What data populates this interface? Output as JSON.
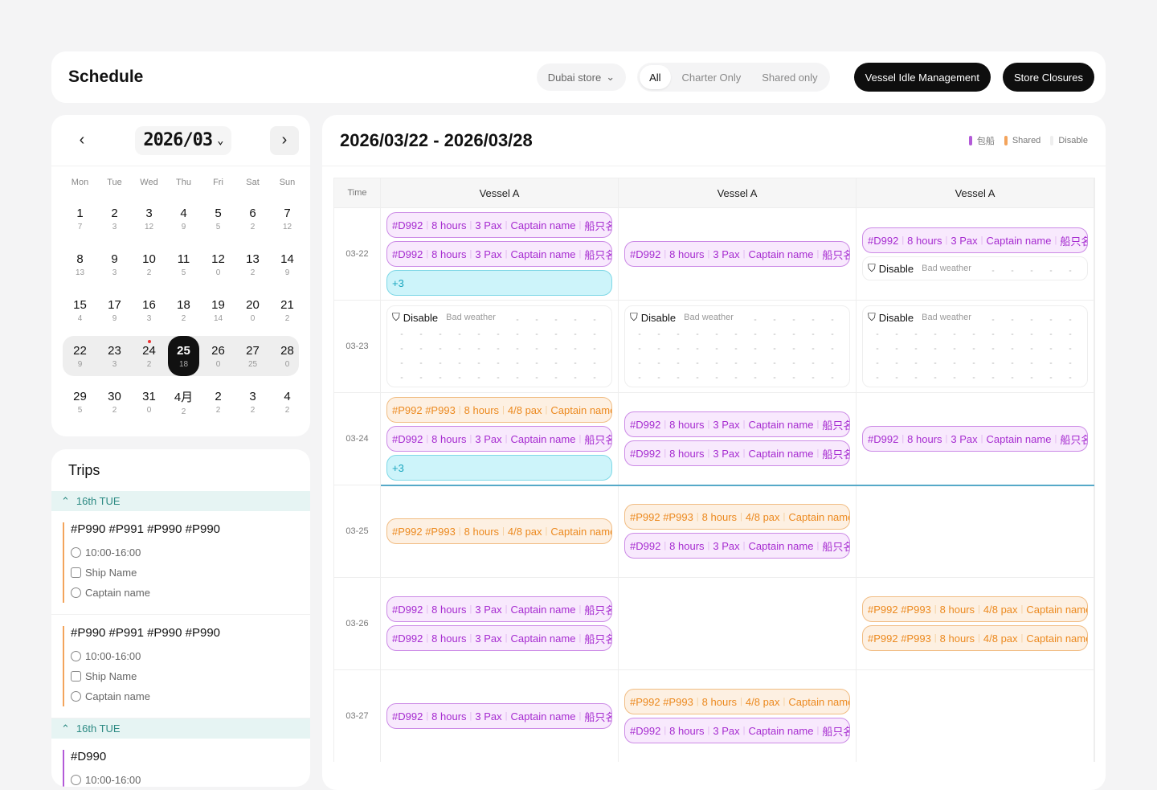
{
  "header": {
    "title": "Schedule",
    "store": "Dubai store",
    "filters": [
      "All",
      "Charter Only",
      "Shared only"
    ],
    "buttons": [
      "Vessel Idle Management",
      "Store Closures"
    ]
  },
  "calendar": {
    "month": "2026/03",
    "weekdays": [
      "Mon",
      "Tue",
      "Wed",
      "Thu",
      "Fri",
      "Sat",
      "Sun"
    ],
    "weeks": [
      [
        [
          "1",
          "7"
        ],
        [
          "2",
          "3"
        ],
        [
          "3",
          "12"
        ],
        [
          "4",
          "9"
        ],
        [
          "5",
          "5"
        ],
        [
          "6",
          "2"
        ],
        [
          "7",
          "12"
        ]
      ],
      [
        [
          "8",
          "13"
        ],
        [
          "9",
          "3"
        ],
        [
          "10",
          "2"
        ],
        [
          "11",
          "5"
        ],
        [
          "12",
          "0"
        ],
        [
          "13",
          "2"
        ],
        [
          "14",
          "9"
        ]
      ],
      [
        [
          "15",
          "4"
        ],
        [
          "17",
          "9"
        ],
        [
          "16",
          "3"
        ],
        [
          "18",
          "2"
        ],
        [
          "19",
          "14"
        ],
        [
          "20",
          "0"
        ],
        [
          "21",
          "2"
        ]
      ],
      [
        [
          "22",
          "9"
        ],
        [
          "23",
          "3"
        ],
        [
          "24",
          "2"
        ],
        [
          "25",
          "18"
        ],
        [
          "26",
          "0"
        ],
        [
          "27",
          "25"
        ],
        [
          "28",
          "0"
        ]
      ],
      [
        [
          "29",
          "5"
        ],
        [
          "30",
          "2"
        ],
        [
          "31",
          "0"
        ],
        [
          "4月",
          "2"
        ],
        [
          "2",
          "2"
        ],
        [
          "3",
          "2"
        ],
        [
          "4",
          "2"
        ]
      ]
    ]
  },
  "trips": {
    "title": "Trips",
    "groups": [
      {
        "label": "16th TUE",
        "items": [
          {
            "code": "#P990 #P991 #P990 #P990",
            "time": "10:00-16:00",
            "ship": "Ship Name",
            "captain": "Captain name"
          },
          {
            "code": "#P990 #P991 #P990 #P990",
            "time": "10:00-16:00",
            "ship": "Ship Name",
            "captain": "Captain name"
          }
        ]
      },
      {
        "label": "16th TUE",
        "items": [
          {
            "code": "#D990",
            "time": "10:00-16:00"
          }
        ]
      }
    ]
  },
  "schedule": {
    "range": "2026/03/22 - 2026/03/28",
    "legend": [
      "包船",
      "Shared",
      "Disable"
    ],
    "time_label": "Time",
    "vessels": [
      "Vessel A",
      "Vessel A",
      "Vessel A"
    ],
    "chip_p": {
      "code": "#D992",
      "hours": "8 hours",
      "pax": "3 Pax",
      "captain": "Captain name",
      "ship": "船只名"
    },
    "chip_o": {
      "code": "#P992 #P993",
      "hours": "8 hours",
      "pax": "4/8 pax",
      "captain": "Captain name"
    },
    "more": "+3",
    "disable": "Disable",
    "reason": "Bad weather",
    "dates": [
      "03-22",
      "03-23",
      "03-24",
      "03-25",
      "03-26",
      "03-27"
    ]
  },
  "colors": {
    "charter": "#b35ad8",
    "shared": "#f3a45c",
    "accent": "#2c8a83"
  }
}
